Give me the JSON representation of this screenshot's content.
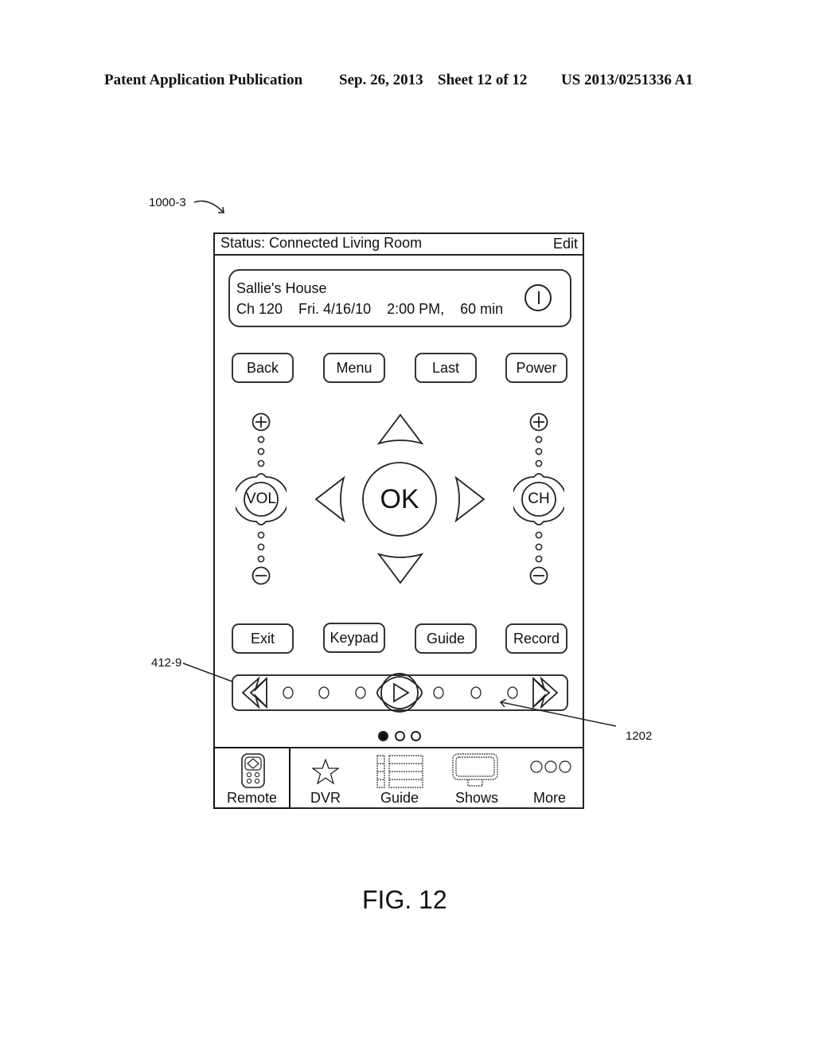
{
  "patent_header": {
    "publication": "Patent Application Publication",
    "date": "Sep. 26, 2013",
    "sheet": "Sheet 12 of 12",
    "number": "US 2013/0251336 A1"
  },
  "reference_labels": {
    "device": "1000-3",
    "transport_bar": "412-9",
    "scrubber": "1202"
  },
  "status_bar": {
    "status": "Status: Connected Living Room",
    "edit": "Edit"
  },
  "now_playing": {
    "title": "Sallie's House",
    "details": "Ch 120    Fri. 4/16/10    2:00 PM,    60 min",
    "icon": "power-icon"
  },
  "top_buttons": [
    "Back",
    "Menu",
    "Last",
    "Power"
  ],
  "volume": {
    "label": "VOL",
    "up_icon": "plus-icon",
    "down_icon": "minus-icon"
  },
  "channel": {
    "label": "CH",
    "up_icon": "plus-icon",
    "down_icon": "minus-icon"
  },
  "dpad": {
    "center": "OK",
    "icons": [
      "arrow-up-icon",
      "arrow-down-icon",
      "arrow-left-icon",
      "arrow-right-icon"
    ]
  },
  "bottom_buttons": [
    "Exit",
    "Keypad",
    "Guide",
    "Record"
  ],
  "transport": {
    "rewind_icon": "rewind-icon",
    "play_icon": "play-icon",
    "forward_icon": "fast-forward-icon",
    "scrub_positions": 6
  },
  "pager": {
    "pages": 3,
    "active": 1
  },
  "tabs": [
    {
      "label": "Remote",
      "icon": "remote-icon",
      "active": true
    },
    {
      "label": "DVR",
      "icon": "star-icon",
      "active": false
    },
    {
      "label": "Guide",
      "icon": "grid-list-icon",
      "active": false
    },
    {
      "label": "Shows",
      "icon": "tv-icon",
      "active": false
    },
    {
      "label": "More",
      "icon": "more-dots-icon",
      "active": false
    }
  ],
  "figure_caption": "FIG. 12"
}
